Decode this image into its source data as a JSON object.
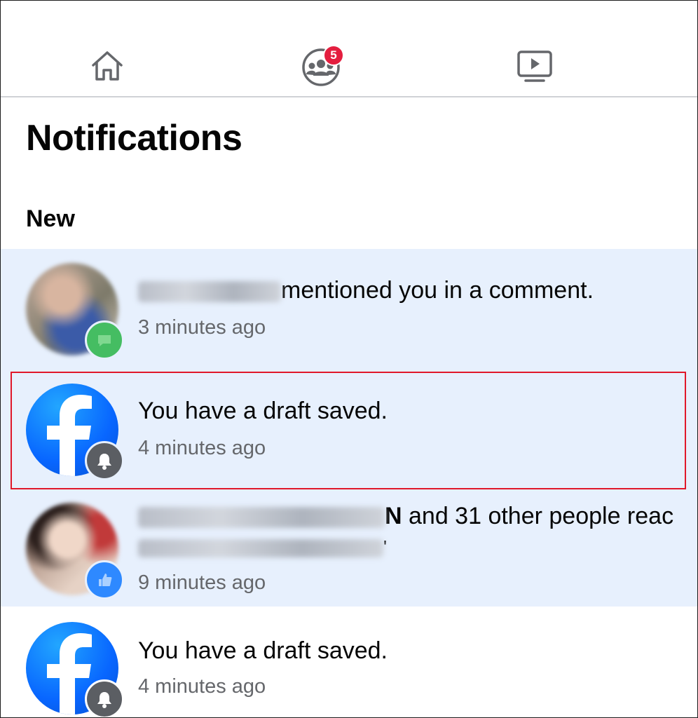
{
  "nav": {
    "tabs": [
      {
        "name": "home",
        "icon": "home-icon"
      },
      {
        "name": "groups",
        "icon": "groups-icon",
        "badge": "5"
      },
      {
        "name": "watch",
        "icon": "video-icon"
      }
    ]
  },
  "page": {
    "title": "Notifications",
    "section": "New"
  },
  "notifications": [
    {
      "actor": "Rahkan Rabi",
      "text": "mentioned you in a comment.",
      "time": "3 minutes ago",
      "badge_icon": "message-icon",
      "badge_color": "#45bd62"
    },
    {
      "text": "You have a draft saved.",
      "time": "4 minutes ago",
      "badge_icon": "bell-icon",
      "badge_color": "#5b5e63"
    },
    {
      "actors": "Ayesha Alam, Raihan",
      "actors_bold": "N",
      "text": " and 31 other people reac",
      "second_line": "songs ama ... ",
      "second_line_end": "'",
      "time": "9 minutes ago",
      "badge_icon": "like-icon",
      "badge_color": "#2e89ff"
    },
    {
      "text": "You have a draft saved.",
      "time": "4 minutes ago",
      "badge_icon": "bell-icon",
      "badge_color": "#5b5e63"
    }
  ],
  "colors": {
    "unread_bg": "#e7f0fd",
    "highlight": "#e0182a",
    "badge": "#e41e3f",
    "brand": "#0866ff"
  }
}
